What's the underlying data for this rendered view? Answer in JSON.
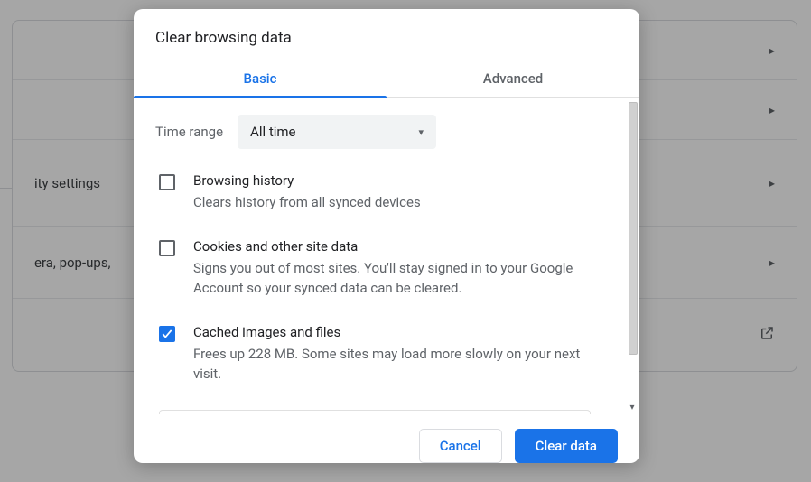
{
  "background": {
    "rows": [
      {
        "text": ""
      },
      {
        "text": ""
      },
      {
        "text": "ity settings"
      },
      {
        "text": "era, pop-ups,"
      },
      {
        "text": ""
      }
    ]
  },
  "dialog": {
    "title": "Clear browsing data",
    "tabs": {
      "basic": "Basic",
      "advanced": "Advanced"
    },
    "time_range": {
      "label": "Time range",
      "value": "All time"
    },
    "options": [
      {
        "title": "Browsing history",
        "desc": "Clears history from all synced devices",
        "checked": false
      },
      {
        "title": "Cookies and other site data",
        "desc": "Signs you out of most sites. You'll stay signed in to your Google Account so your synced data can be cleared.",
        "checked": false
      },
      {
        "title": "Cached images and files",
        "desc": "Frees up 228 MB. Some sites may load more slowly on your next visit.",
        "checked": true
      }
    ],
    "buttons": {
      "cancel": "Cancel",
      "clear": "Clear data"
    }
  }
}
